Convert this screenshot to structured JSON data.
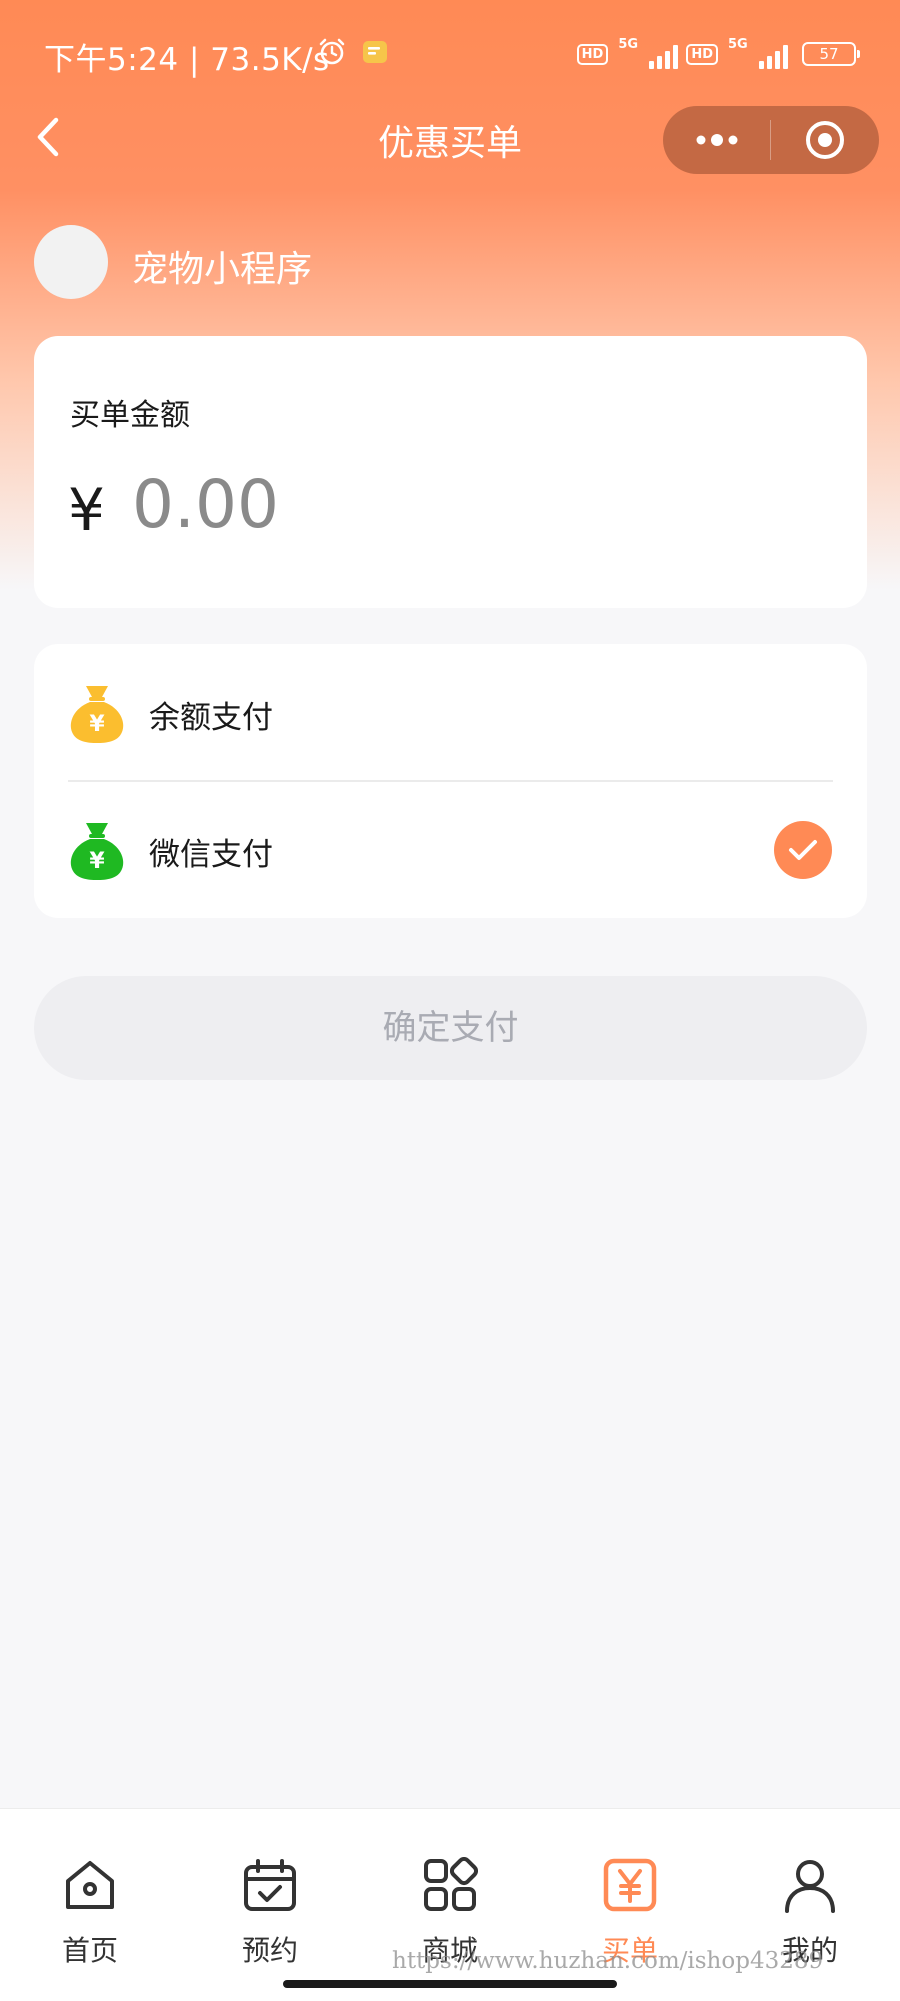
{
  "colors": {
    "accent": "#FF8A55",
    "balance_icon": "#FBBE2F",
    "wechat_icon": "#1FB922",
    "background": "#F7F7F9",
    "disabled_text": "#A9ABB3"
  },
  "status_bar": {
    "time": "下午5:24 | 73.5K/s",
    "hd_badge": "HD",
    "network": "5G",
    "battery": "57"
  },
  "nav": {
    "title": "优惠买单",
    "back_icon": "chevron-left-icon",
    "more_icon": "more-dots-icon",
    "close_icon": "target-close-icon"
  },
  "store": {
    "name": "宠物小程序"
  },
  "amount": {
    "label": "买单金额",
    "currency": "¥",
    "placeholder": "0.00"
  },
  "payment": {
    "methods": [
      {
        "label": "余额支付",
        "icon": "money-bag-icon",
        "selected": false
      },
      {
        "label": "微信支付",
        "icon": "money-bag-icon",
        "selected": true
      }
    ]
  },
  "confirm": {
    "label": "确定支付"
  },
  "tabbar": {
    "tabs": [
      {
        "label": "首页",
        "icon": "home-icon"
      },
      {
        "label": "预约",
        "icon": "calendar-icon"
      },
      {
        "label": "商城",
        "icon": "grid-icon"
      },
      {
        "label": "买单",
        "icon": "yen-icon",
        "active": true
      },
      {
        "label": "我的",
        "icon": "user-icon"
      }
    ]
  },
  "watermark": "https://www.huzhan.com/ishop43289"
}
